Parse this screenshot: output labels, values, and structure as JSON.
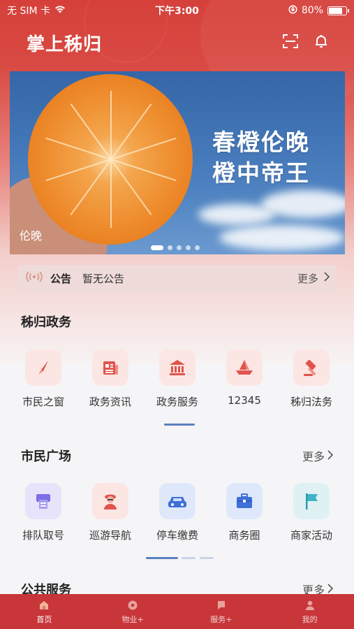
{
  "status_bar": {
    "carrier": "无 SIM 卡",
    "time": "下午3:00",
    "battery_percent": "80%",
    "battery_level": 0.8
  },
  "header": {
    "title": "掌上秭归"
  },
  "banner": {
    "headline_line1": "春橙伦晚",
    "headline_line2": "橙中帝王",
    "caption": "伦晚",
    "slide_count": 5,
    "active_slide": 1
  },
  "notice": {
    "label": "公告",
    "text": "暂无公告",
    "more": "更多"
  },
  "gov_section": {
    "title": "秭归政务",
    "items": [
      {
        "label": "市民之窗",
        "icon": "compass-icon"
      },
      {
        "label": "政务资讯",
        "icon": "newspaper-icon"
      },
      {
        "label": "政务服务",
        "icon": "government-building-icon"
      },
      {
        "label": "12345",
        "icon": "paper-boat-icon"
      },
      {
        "label": "秭归法务",
        "icon": "gavel-icon"
      }
    ]
  },
  "plaza_section": {
    "title": "市民广场",
    "more": "更多",
    "items": [
      {
        "label": "排队取号",
        "icon": "ticket-machine-icon"
      },
      {
        "label": "巡游导航",
        "icon": "tour-guide-icon"
      },
      {
        "label": "停车缴费",
        "icon": "car-icon"
      },
      {
        "label": "商务圈",
        "icon": "briefcase-icon"
      },
      {
        "label": "商家活动",
        "icon": "flag-icon"
      }
    ]
  },
  "public_section": {
    "title": "公共服务",
    "more": "更多"
  },
  "tabbar": {
    "tabs": [
      {
        "label": "首页",
        "icon": "home-icon",
        "active": true
      },
      {
        "label": "物业+",
        "icon": "settings-icon",
        "active": false
      },
      {
        "label": "服务+",
        "icon": "service-flag-icon",
        "active": false
      },
      {
        "label": "我的",
        "icon": "user-icon",
        "active": false
      }
    ]
  },
  "colors": {
    "brand_red": "#d6403a",
    "tabbar_red": "#c8363a",
    "gov_icon_bg": "#fbe6e4",
    "gov_icon_fg": "#e0544c",
    "indicator_blue": "#5b7fbf"
  }
}
